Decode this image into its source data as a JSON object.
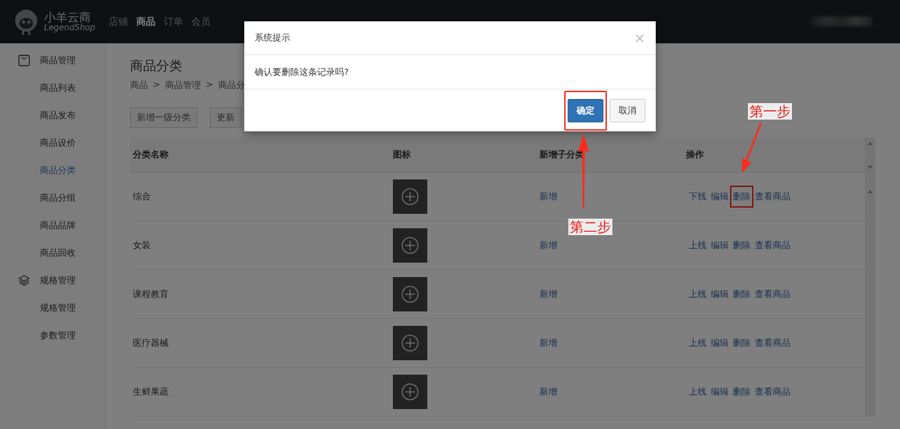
{
  "brand": {
    "name": "小羊云商",
    "subtitle": "LegendShop"
  },
  "top_nav": [
    {
      "label": "店铺",
      "selected": false
    },
    {
      "label": "商品",
      "selected": true
    },
    {
      "label": "订单",
      "selected": false
    },
    {
      "label": "会员",
      "selected": false
    }
  ],
  "sidebar": [
    {
      "label": "商品管理",
      "kind": "group",
      "selected": false
    },
    {
      "label": "商品列表",
      "kind": "item",
      "selected": false
    },
    {
      "label": "商品发布",
      "kind": "item",
      "selected": false
    },
    {
      "label": "商品设价",
      "kind": "item",
      "selected": false
    },
    {
      "label": "商品分类",
      "kind": "item",
      "selected": true
    },
    {
      "label": "商品分组",
      "kind": "item",
      "selected": false
    },
    {
      "label": "商品品牌",
      "kind": "item",
      "selected": false
    },
    {
      "label": "商品回收",
      "kind": "item",
      "selected": false
    },
    {
      "label": "规格管理",
      "kind": "group",
      "selected": false
    },
    {
      "label": "规格管理",
      "kind": "item",
      "selected": false
    },
    {
      "label": "参数管理",
      "kind": "item",
      "selected": false
    }
  ],
  "page": {
    "title": "商品分类",
    "breadcrumb": [
      "商品",
      "商品管理",
      "商品分"
    ],
    "separator": ">",
    "buttons": [
      "新增一级分类",
      "更新"
    ]
  },
  "table": {
    "columns": [
      "分类名称",
      "图标",
      "新增子分类",
      "操作"
    ],
    "rows": [
      {
        "name": "综合",
        "add": "新增",
        "actions": [
          {
            "label": "下线",
            "highlighted": false
          },
          {
            "label": "编辑",
            "highlighted": false
          },
          {
            "label": "删除",
            "highlighted": true
          },
          {
            "label": "查看商品",
            "highlighted": false
          }
        ]
      },
      {
        "name": "女装",
        "add": "新增",
        "actions": [
          {
            "label": "上线",
            "highlighted": false
          },
          {
            "label": "编辑",
            "highlighted": false
          },
          {
            "label": "删除",
            "highlighted": false
          },
          {
            "label": "查看商品",
            "highlighted": false
          }
        ]
      },
      {
        "name": "课程教育",
        "add": "新增",
        "actions": [
          {
            "label": "上线",
            "highlighted": false
          },
          {
            "label": "编辑",
            "highlighted": false
          },
          {
            "label": "删除",
            "highlighted": false
          },
          {
            "label": "查看商品",
            "highlighted": false
          }
        ]
      },
      {
        "name": "医疗器械",
        "add": "新增",
        "actions": [
          {
            "label": "上线",
            "highlighted": false
          },
          {
            "label": "编辑",
            "highlighted": false
          },
          {
            "label": "删除",
            "highlighted": false
          },
          {
            "label": "查看商品",
            "highlighted": false
          }
        ]
      },
      {
        "name": "生鲜果蔬",
        "add": "新增",
        "actions": [
          {
            "label": "上线",
            "highlighted": false
          },
          {
            "label": "编辑",
            "highlighted": false
          },
          {
            "label": "删除",
            "highlighted": false
          },
          {
            "label": "查看商品",
            "highlighted": false
          }
        ]
      }
    ]
  },
  "dialog": {
    "title": "系统提示",
    "close": "×",
    "message": "确认要删除这条记录吗?",
    "confirm": "确定",
    "cancel": "取消",
    "confirm_highlighted": true
  },
  "annotations": [
    {
      "label": "第一步"
    },
    {
      "label": "第二步"
    }
  ]
}
